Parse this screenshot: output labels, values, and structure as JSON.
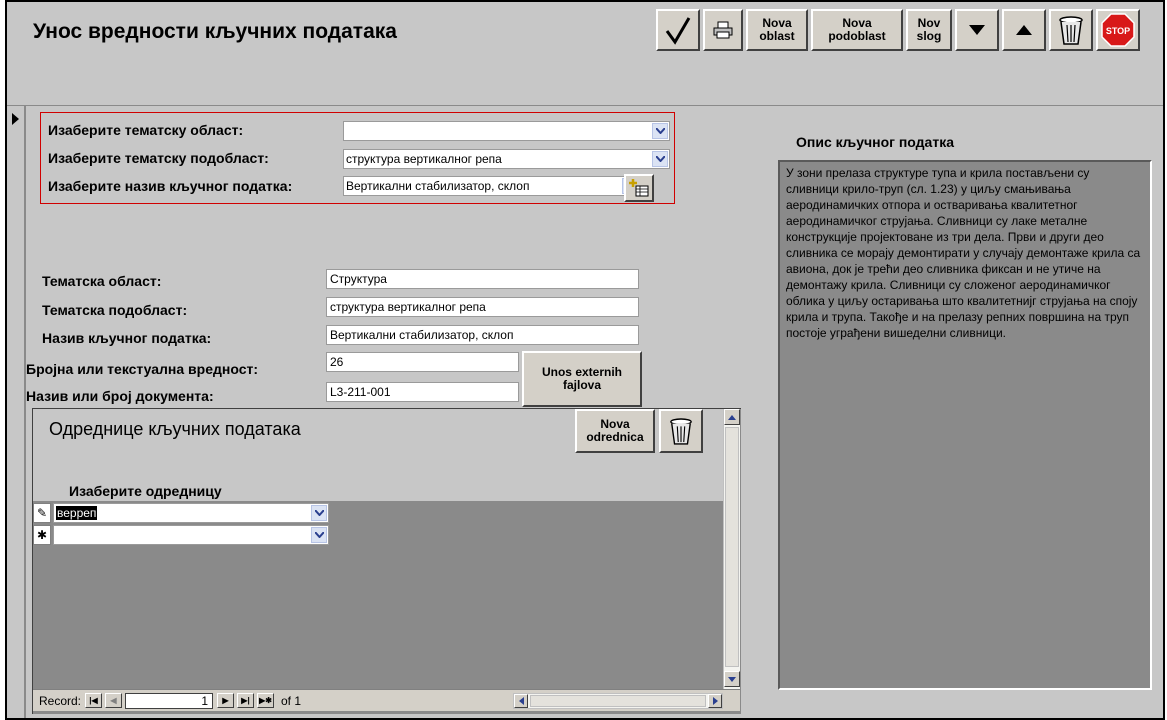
{
  "app": {
    "title": "Унос вредности кључних података"
  },
  "toolbar": {
    "save_icon": "checkmark-icon",
    "print_icon": "printer-icon",
    "new_area_label": "Nova oblast",
    "new_subarea_label": "Nova podoblast",
    "new_record_label": "Nov slog",
    "next_icon": "arrow-down-icon",
    "prev_icon": "arrow-up-icon",
    "delete_icon": "trash-icon",
    "stop_label": "STOP",
    "stop_color": "#d81818"
  },
  "selection": {
    "area_label": "Изаберите тематску област:",
    "area_value": "",
    "subarea_label": "Изаберите тематску подобласт:",
    "subarea_value": "структура вертикалног репа",
    "keydata_label": "Изаберите назив кључног податка:",
    "keydata_value": "Вертикални стабилизатор, склоп"
  },
  "details": {
    "area_label": "Тематска област:",
    "area_value": "Структура",
    "subarea_label": "Тематска подобласт:",
    "subarea_value": "структура вертикалног репа",
    "keydata_label": "Назив кључног податка:",
    "keydata_value": "Вертикални стабилизатор, склоп",
    "value_label": "Бројна или текстуална вредност:",
    "value_value": "26",
    "doc_label": "Назив или број документа:",
    "doc_value": "L3-211-001",
    "external_button": "Unos externih fajlova"
  },
  "description": {
    "title": "Опис кључног податка",
    "text": "У зони прелаза структуре тупа и крила постављени су сливници крило-труп (сл. 1.23) у циљу смањивања аеродинамичких отпора и остваривања квалитетног аеродинамичког струјања. Сливници су лаке металне конструкције пројектоване из три дела. Први и други део сливника се морају демонтирати у случају демонтаже крила са авиона, док је трећи део сливника фиксан и не утиче на демонтажу крила. Сливници су сложеног аеродинамичког облика у циљу остаривања што квалитетнијг струјања на споју крила и трупа. Такође и на прелазу репних површина на труп постоје уграђени вишеделни сливници."
  },
  "subform": {
    "title": "Одреднице кључних података",
    "new_button": "Nova odrednica",
    "column_label": "Изаберите одредницу",
    "rows": [
      {
        "selector": "✎",
        "value": "верреп"
      },
      {
        "selector": "✱",
        "value": ""
      }
    ]
  },
  "navigation": {
    "record_label": "Record:",
    "current": "1",
    "of_label": "of 1"
  }
}
